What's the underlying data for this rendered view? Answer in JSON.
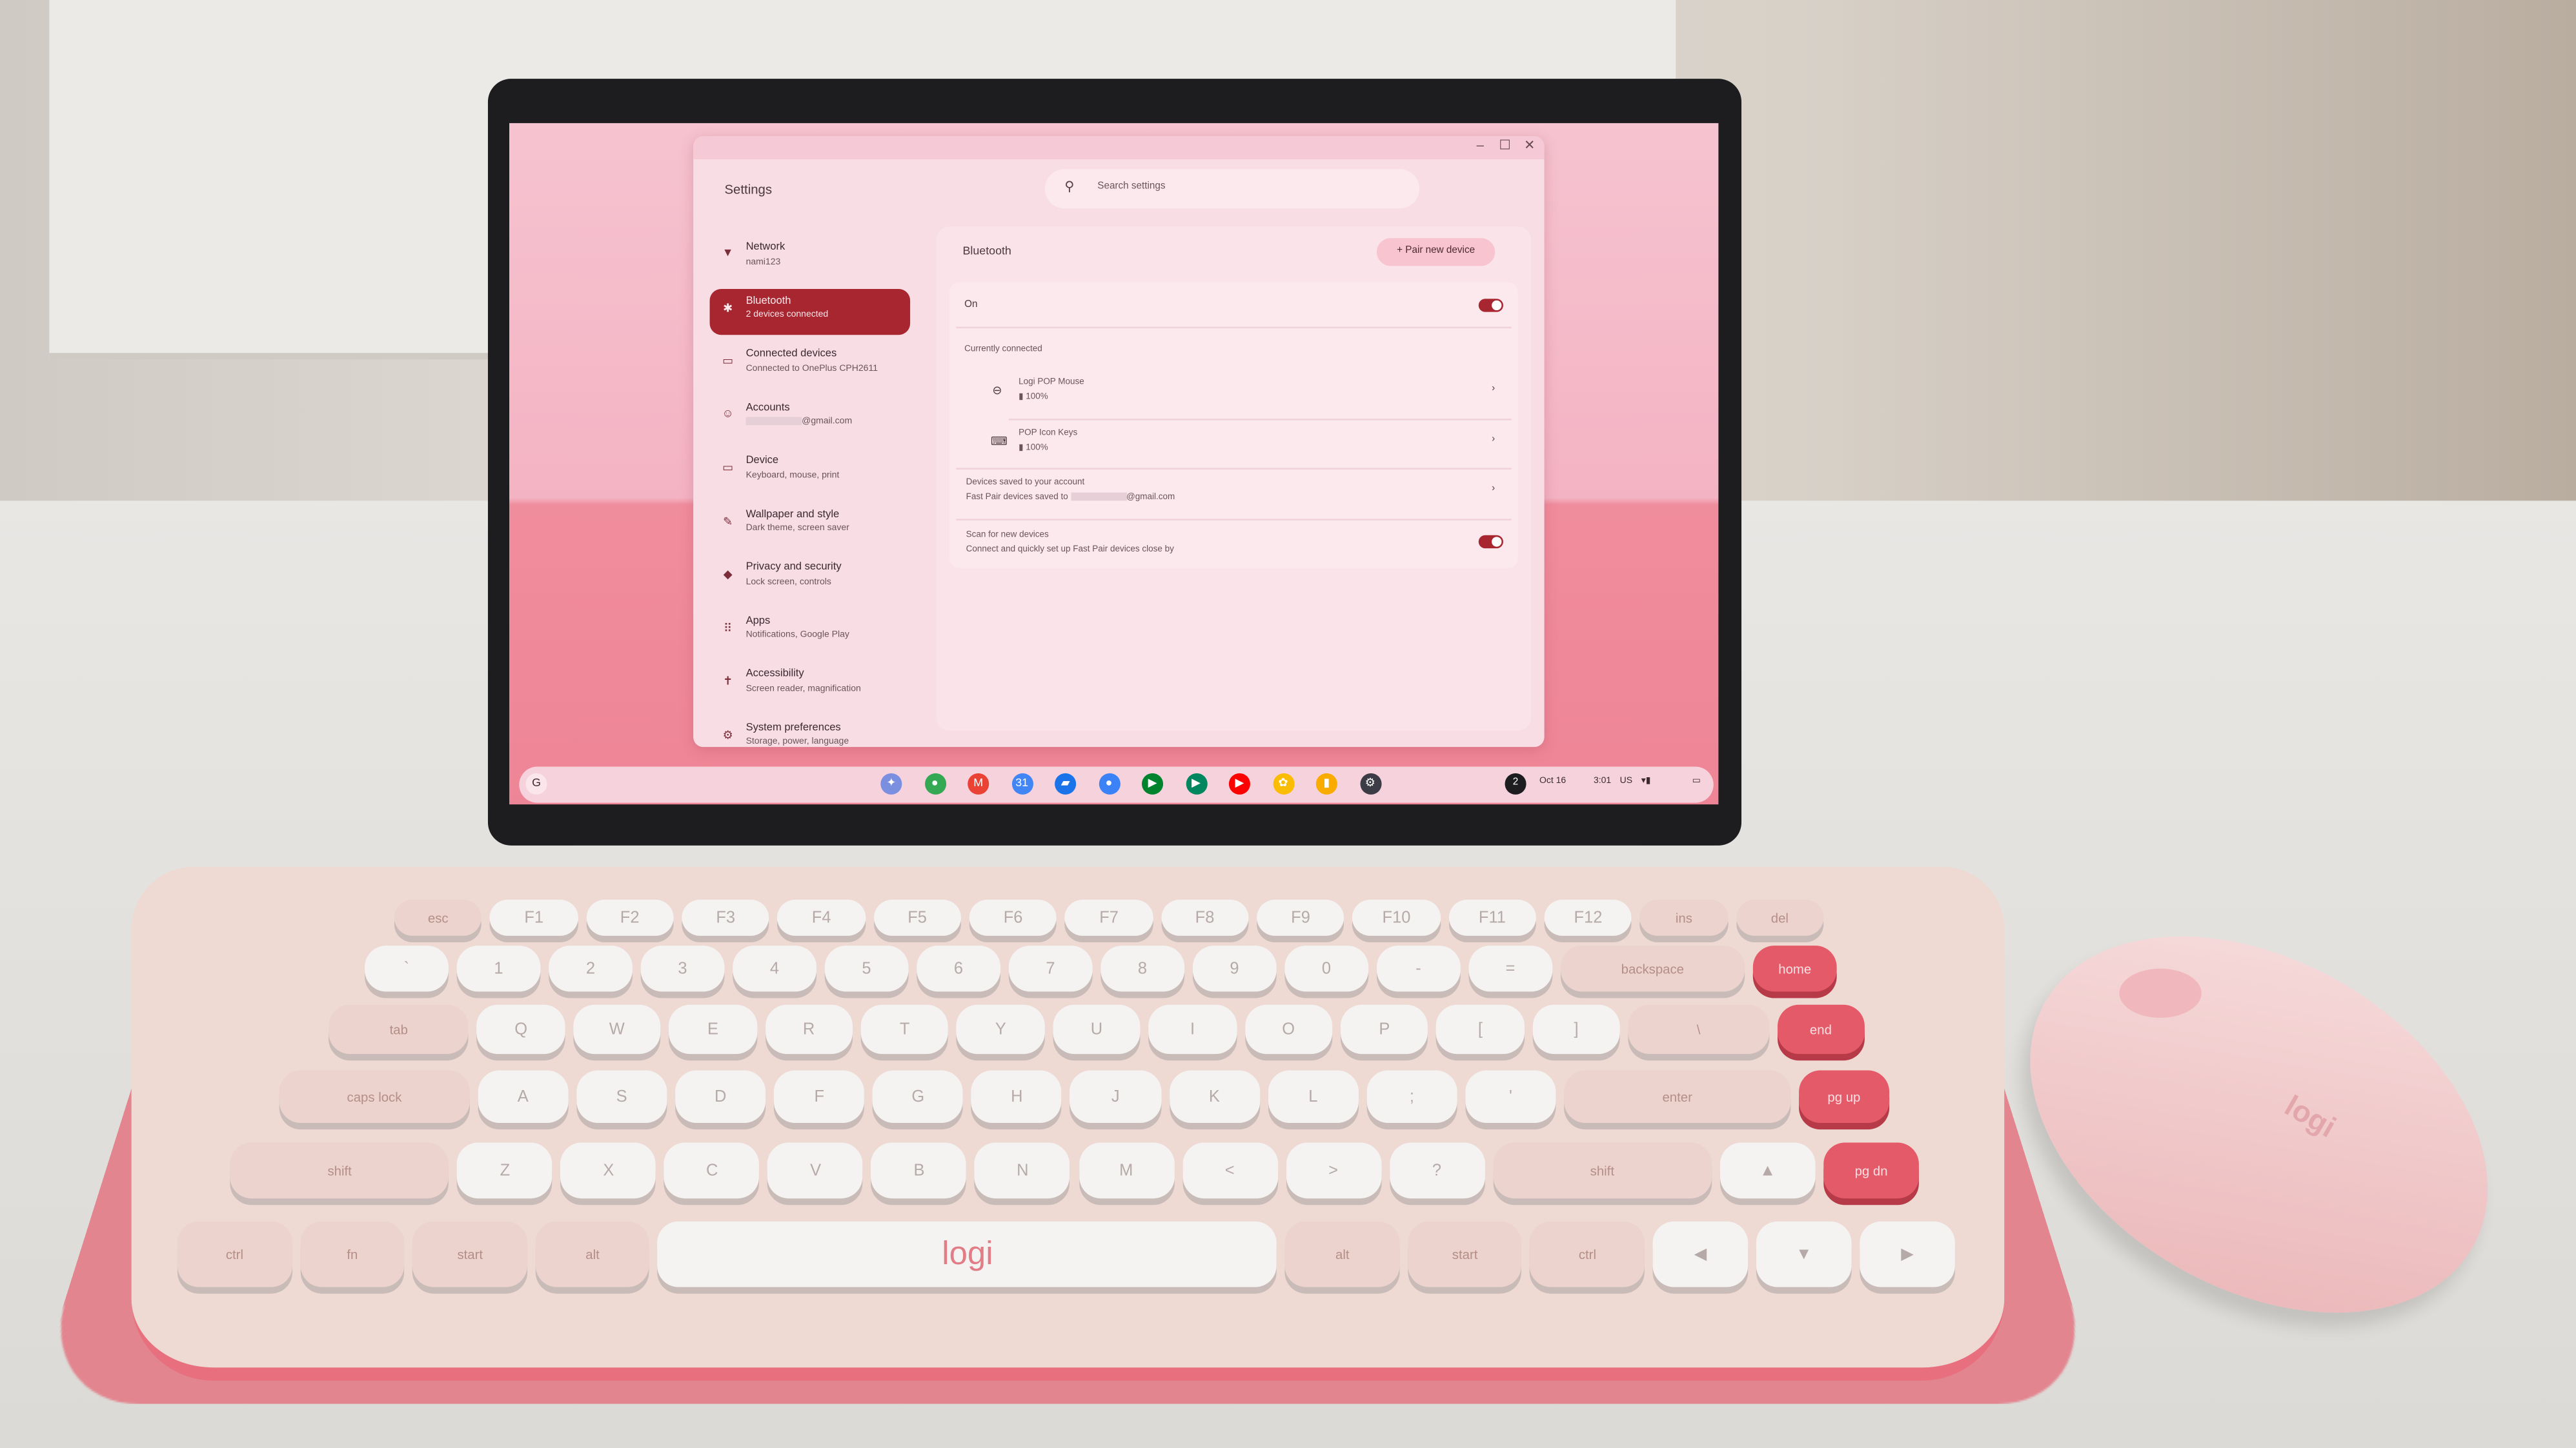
{
  "window": {
    "title": "Settings",
    "controls": [
      "–",
      "☐",
      "✕"
    ]
  },
  "search": {
    "placeholder": "Search settings"
  },
  "sidebar": {
    "items": [
      {
        "label": "Network",
        "sub": "nami123",
        "icon": "wifi-icon",
        "glyph": "▼"
      },
      {
        "label": "Bluetooth",
        "sub": "2 devices connected",
        "icon": "bluetooth-icon",
        "glyph": "✱",
        "selected": true
      },
      {
        "label": "Connected devices",
        "sub": "Connected to OnePlus CPH2611",
        "icon": "connected-devices-icon",
        "glyph": "▭"
      },
      {
        "label": "Accounts",
        "sub": "@gmail.com",
        "icon": "account-icon",
        "glyph": "☺"
      },
      {
        "label": "Device",
        "sub": "Keyboard, mouse, print",
        "icon": "laptop-icon",
        "glyph": "▭"
      },
      {
        "label": "Wallpaper and style",
        "sub": "Dark theme, screen saver",
        "icon": "palette-icon",
        "glyph": "✎"
      },
      {
        "label": "Privacy and security",
        "sub": "Lock screen, controls",
        "icon": "shield-icon",
        "glyph": "◆"
      },
      {
        "label": "Apps",
        "sub": "Notifications, Google Play",
        "icon": "apps-grid-icon",
        "glyph": "⠿"
      },
      {
        "label": "Accessibility",
        "sub": "Screen reader, magnification",
        "icon": "accessibility-icon",
        "glyph": "✝"
      },
      {
        "label": "System preferences",
        "sub": "Storage, power, language",
        "icon": "gear-icon",
        "glyph": "⚙"
      }
    ]
  },
  "bluetooth": {
    "title": "Bluetooth",
    "pair_label": "+ Pair new device",
    "on_label": "On",
    "on": true,
    "currently_connected": "Currently connected",
    "devices": [
      {
        "name": "Logi POP Mouse",
        "battery": "▮ 100%",
        "icon": "mouse-icon"
      },
      {
        "name": "POP Icon Keys",
        "battery": "▮ 100%",
        "icon": "keyboard-icon"
      }
    ],
    "saved_title": "Devices saved to your account",
    "saved_sub": "Fast Pair devices saved to",
    "saved_email": "@gmail.com",
    "scan_title": "Scan for new devices",
    "scan_sub": "Connect and quickly set up Fast Pair devices close by",
    "scan_on": true
  },
  "shelf": {
    "launcher": "G",
    "apps": [
      {
        "name": "gemini",
        "color": "#7b8fe0",
        "g": "✦"
      },
      {
        "name": "chrome",
        "color": "#34a853",
        "g": "●"
      },
      {
        "name": "gmail",
        "color": "#ea4335",
        "g": "M"
      },
      {
        "name": "calendar",
        "color": "#4285f4",
        "g": "31"
      },
      {
        "name": "files",
        "color": "#1a73e8",
        "g": "▰"
      },
      {
        "name": "messages",
        "color": "#3b82f6",
        "g": "●"
      },
      {
        "name": "meet",
        "color": "#00832d",
        "g": "▶"
      },
      {
        "name": "play-store",
        "color": "#01875f",
        "g": "▶"
      },
      {
        "name": "youtube",
        "color": "#ff0000",
        "g": "▶"
      },
      {
        "name": "photos",
        "color": "#fbbc04",
        "g": "✿"
      },
      {
        "name": "keep",
        "color": "#f9ab00",
        "g": "▮"
      },
      {
        "name": "settings",
        "color": "#3c3c46",
        "g": "⚙"
      }
    ],
    "notification_count": "2",
    "date": "Oct 16",
    "time": "3:01",
    "ime": "US"
  },
  "keyboard": {
    "brand": "logi",
    "rows": [
      [
        "esc",
        "F1",
        "F2",
        "F3",
        "F4",
        "F5",
        "F6",
        "F7",
        "F8",
        "F9",
        "F10",
        "F11",
        "F12",
        "ins",
        "del"
      ],
      [
        "`",
        "1",
        "2",
        "3",
        "4",
        "5",
        "6",
        "7",
        "8",
        "9",
        "0",
        "-",
        "=",
        "backspace",
        "home"
      ],
      [
        "tab",
        "Q",
        "W",
        "E",
        "R",
        "T",
        "Y",
        "U",
        "I",
        "O",
        "P",
        "[",
        "]",
        "\\",
        "end"
      ],
      [
        "caps lock",
        "A",
        "S",
        "D",
        "F",
        "G",
        "H",
        "J",
        "K",
        "L",
        ";",
        "'",
        "enter",
        "pg up"
      ],
      [
        "shift",
        "Z",
        "X",
        "C",
        "V",
        "B",
        "N",
        "M",
        "<",
        ">",
        "?",
        "shift",
        "▲",
        "pg dn"
      ],
      [
        "ctrl",
        "fn",
        "start",
        "alt",
        "logi",
        "alt",
        "start",
        "ctrl",
        "◀",
        "▼",
        "▶"
      ]
    ]
  },
  "mouse": {
    "brand": "logi"
  }
}
